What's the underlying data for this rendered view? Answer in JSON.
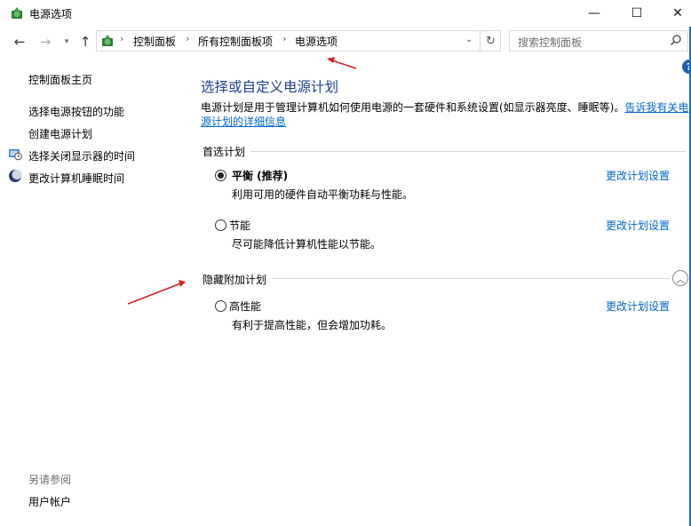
{
  "window": {
    "title": "电源选项",
    "minimize_glyph": "—",
    "maximize_glyph": "☐",
    "close_glyph": "✕"
  },
  "nav": {
    "back_icon": "arrow-left-icon",
    "forward_icon": "arrow-right-icon",
    "recent_icon": "chevron-down-icon",
    "up_icon": "arrow-up-icon",
    "breadcrumbs": [
      "控制面板",
      "所有控制面板项",
      "电源选项"
    ],
    "refresh_icon": "refresh-icon",
    "search_placeholder": "搜索控制面板"
  },
  "sidebar": {
    "home": "控制面板主页",
    "links": [
      {
        "label": "选择电源按钮的功能",
        "icon": ""
      },
      {
        "label": "创建电源计划",
        "icon": ""
      },
      {
        "label": "选择关闭显示器的时间",
        "icon": "monitor-clock-icon"
      },
      {
        "label": "更改计算机睡眠时间",
        "icon": "moon-icon"
      }
    ],
    "see_also": "另请参阅",
    "user_accounts": "用户帐户"
  },
  "main": {
    "title": "选择或自定义电源计划",
    "description": "电源计划是用于管理计算机如何使用电源的一套硬件和系统设置(如显示器亮度、睡眠等)。",
    "description_link": "告诉我有关电源计划的详细信息",
    "preferred_label": "首选计划",
    "hidden_label": "隐藏附加计划",
    "plans": [
      {
        "name": "平衡 (推荐)",
        "desc": "利用可用的硬件自动平衡功耗与性能。",
        "selected": true,
        "change": "更改计划设置"
      },
      {
        "name": "节能",
        "desc": "尽可能降低计算机性能以节能。",
        "selected": false,
        "change": "更改计划设置"
      },
      {
        "name": "高性能",
        "desc": "有利于提高性能，但会增加功耗。",
        "selected": false,
        "change": "更改计划设置"
      }
    ],
    "help_glyph": "?"
  },
  "colors": {
    "title_blue": "#1e3e95",
    "link_blue": "#0066cc",
    "annotation_red": "#d42020"
  }
}
